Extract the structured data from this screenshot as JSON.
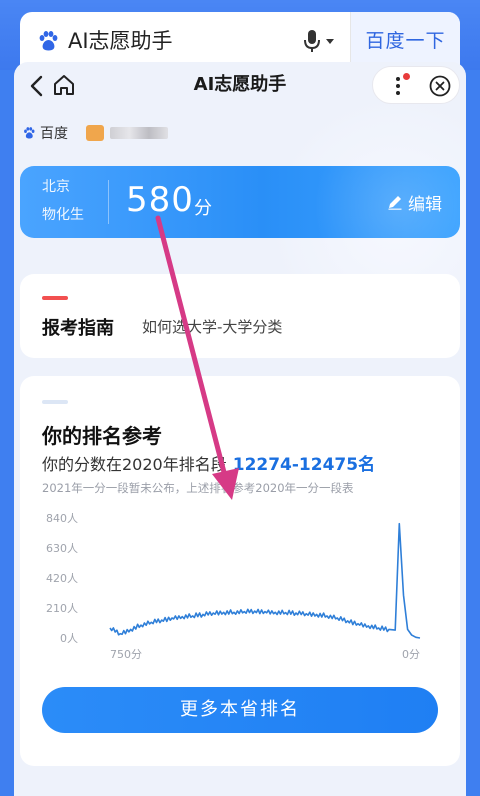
{
  "search": {
    "query": "AI志愿助手",
    "button_label": "百度一下"
  },
  "nav": {
    "title": "AI志愿助手"
  },
  "source": {
    "label": "百度"
  },
  "score_card": {
    "province": "北京",
    "subjects": "物化生",
    "score": "580",
    "unit": "分",
    "edit_label": "编辑"
  },
  "guide": {
    "title": "报考指南",
    "subtitle": "如何选大学-大学分类"
  },
  "ranking": {
    "title": "你的排名参考",
    "line_prefix": "你的分数在2020年排名段",
    "range": "12274-12475名",
    "note": "2021年一分一段暂未公布，上述排名参考2020年一分一段表",
    "more_button": "更多本省排名"
  },
  "chart_data": {
    "type": "line",
    "xlabel": "",
    "ylabel": "",
    "x_tick_labels": [
      "750分",
      "0分"
    ],
    "y_tick_labels": [
      "0人",
      "210人",
      "420人",
      "630人",
      "840人"
    ],
    "ylim": [
      0,
      840
    ],
    "x": [
      750,
      725,
      700,
      675,
      650,
      625,
      600,
      575,
      550,
      525,
      500,
      475,
      450,
      425,
      400,
      375,
      350,
      325,
      300,
      275,
      250,
      225,
      200,
      175,
      150,
      125,
      100,
      75,
      60,
      50,
      40,
      30,
      20,
      10,
      0
    ],
    "series": [
      {
        "values": [
          70,
          30,
          60,
          90,
          110,
          125,
          140,
          150,
          155,
          165,
          175,
          180,
          180,
          185,
          188,
          185,
          180,
          178,
          175,
          170,
          165,
          155,
          140,
          120,
          100,
          85,
          70,
          60,
          55,
          800,
          300,
          60,
          20,
          5,
          0
        ]
      }
    ],
    "color": "#2f7fd8",
    "grid": false
  },
  "colors": {
    "accent": "#2a8ff7",
    "rank_highlight": "#1a6fe0",
    "annotation": "#d63a86"
  }
}
